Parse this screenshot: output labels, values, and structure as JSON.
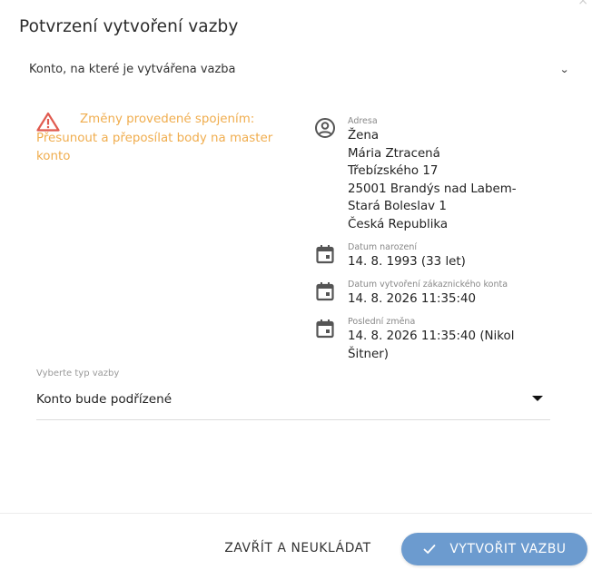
{
  "dialog": {
    "title": "Potvrzení vytvoření vazby",
    "close_symbol": "×"
  },
  "account_select": {
    "label": "Konto, na které je vytvářena vazba",
    "chevron": "⌄"
  },
  "warning": {
    "icon": "warning-triangle-icon",
    "line1": "Změny provedené spojením:",
    "line2": "Přesunout a přeposílat body na master konto"
  },
  "info": {
    "address": {
      "icon": "account-circle-icon",
      "caption": "Adresa",
      "lines": [
        "Žena",
        "Mária Ztracená",
        "Třebízského 17",
        "25001 Brandýs nad Labem-",
        "Stará Boleslav 1",
        "Česká Republika"
      ]
    },
    "birth": {
      "icon": "calendar-icon",
      "caption": "Datum narození",
      "value": "14. 8. 1993 (33 let)"
    },
    "created": {
      "icon": "calendar-icon",
      "caption": "Datum vytvoření zákaznického konta",
      "value": "14. 8. 2026 11:35:40"
    },
    "last_change": {
      "icon": "calendar-icon",
      "caption": "Poslední změna",
      "value_line1": "14. 8. 2026 11:35:40 (Nikol",
      "value_line2": "Šitner)"
    }
  },
  "link_type": {
    "caption": "Vyberte typ vazby",
    "value": "Konto bude podřízené"
  },
  "footer": {
    "close_label": "ZAVŘÍT A NEUKLÁDAT",
    "create_label": "VYTVOŘIT VAZBU"
  },
  "colors": {
    "warning": "#f0ad4e",
    "warning_icon": "#e05a4f",
    "primary_button": "#6c9bcf",
    "icon_gray": "#555555"
  }
}
